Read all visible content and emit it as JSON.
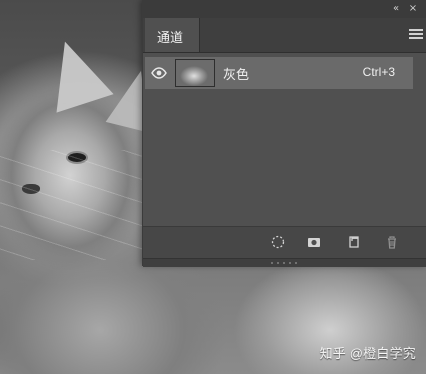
{
  "panel": {
    "tabs": [
      {
        "label": "通道"
      }
    ],
    "channels": [
      {
        "name": "灰色",
        "shortcut": "Ctrl+3"
      }
    ],
    "tools": [
      {
        "icon": "load-selection-icon"
      },
      {
        "icon": "save-selection-mask-icon"
      },
      {
        "icon": "new-channel-icon"
      },
      {
        "icon": "delete-channel-icon"
      }
    ]
  },
  "watermark": {
    "text": "知乎 @橙白学究"
  },
  "colors": {
    "panel_bg": "#505050",
    "panel_header": "#3b3b3b",
    "selected_row": "#6a6a6a",
    "text": "#f0f0f0"
  }
}
